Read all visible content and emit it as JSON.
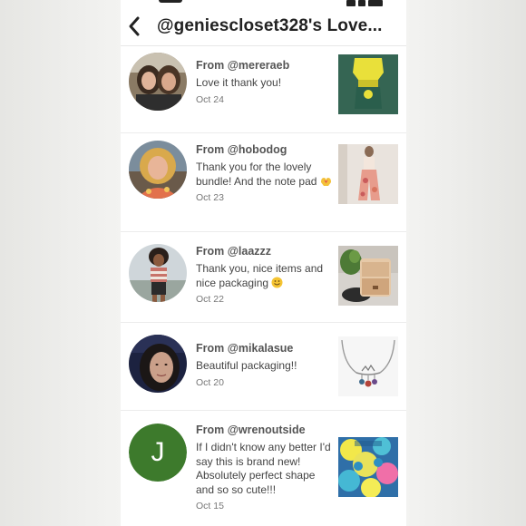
{
  "header": {
    "title": "@geniescloset328's Love..."
  },
  "notes": [
    {
      "from": "From @mereraeb",
      "message": "Love it thank you!",
      "date": "Oct 24",
      "avatar_icon": "photo-avatar",
      "thumbnail_icon": "green-yellow-top-photo"
    },
    {
      "from": "From @hobodog",
      "message": "Thank you for the lovely bundle! And the note pad",
      "emoji": "heart-hands-emoji",
      "date": "Oct 23",
      "avatar_icon": "photo-avatar",
      "thumbnail_icon": "floral-pants-photo"
    },
    {
      "from": "From @laazzz",
      "message": "Thank you, nice items and nice packaging",
      "emoji": "smiling-face-emoji",
      "date": "Oct 22",
      "avatar_icon": "photo-avatar",
      "thumbnail_icon": "jewelry-box-photo"
    },
    {
      "from": "From @mikalasue",
      "message": "Beautiful packaging!!",
      "date": "Oct 20",
      "avatar_icon": "photo-avatar",
      "thumbnail_icon": "necklace-photo"
    },
    {
      "from": "From @wrenoutside",
      "message": "If I didn't know any better I'd say this is brand new! Absolutely perfect shape and so so cute!!!",
      "date": "Oct 15",
      "avatar_letter": "J",
      "avatar_color": "#3d7a2c",
      "thumbnail_icon": "tie-dye-shirt-photo"
    }
  ],
  "colors": {
    "text_primary": "#222222",
    "text_secondary": "#777777",
    "divider": "#ececec"
  }
}
